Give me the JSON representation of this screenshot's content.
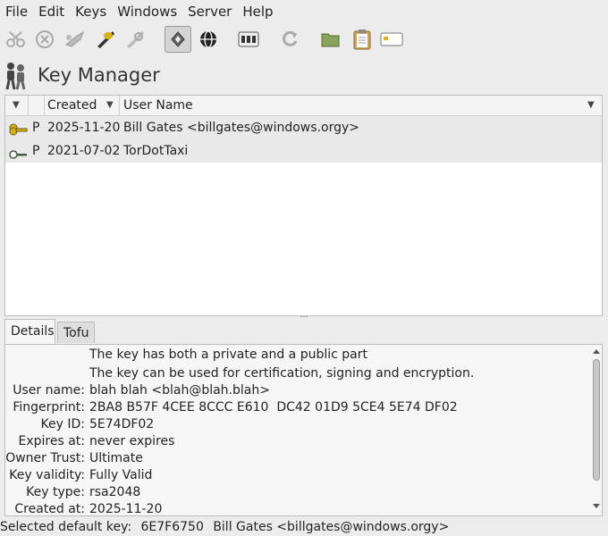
{
  "menu": [
    "File",
    "Edit",
    "Keys",
    "Windows",
    "Server",
    "Help"
  ],
  "toolbar": {
    "buttons": [
      {
        "icon": "scissors-icon",
        "enabled": false
      },
      {
        "icon": "delete-icon",
        "enabled": false
      },
      {
        "icon": "sign-key-icon",
        "enabled": false
      },
      {
        "icon": "edit-key-icon",
        "enabled": true
      },
      {
        "icon": "edit-key-alt-icon",
        "enabled": false
      },
      {
        "icon": "key-manager-icon",
        "enabled": true,
        "active": true
      },
      {
        "icon": "globe-icon",
        "enabled": true
      },
      {
        "icon": "keyring-icon",
        "enabled": true
      },
      {
        "icon": "refresh-icon",
        "enabled": false
      },
      {
        "icon": "folder-icon",
        "enabled": true
      },
      {
        "icon": "clipboard-icon",
        "enabled": true
      },
      {
        "icon": "card-icon",
        "enabled": true
      }
    ]
  },
  "page": {
    "title": "Key Manager",
    "icon": "keys-people-icon"
  },
  "table": {
    "headers": {
      "col0": "",
      "col1": "",
      "created": "Created",
      "user_name": "User Name"
    },
    "rows": [
      {
        "icon": "key-pair-icon",
        "type": "P",
        "created": "2025-11-20",
        "user_name": "Bill Gates <billgates@windows.orgy>"
      },
      {
        "icon": "public-key-icon",
        "type": "P",
        "created": "2021-07-02",
        "user_name": "TorDotTaxi"
      }
    ]
  },
  "tabs": [
    {
      "label": "Details",
      "active": true
    },
    {
      "label": "Tofu",
      "active": false
    }
  ],
  "details": {
    "note1": "The key has both a private and a public part",
    "note2": "The key can be used for certification, signing and encryption.",
    "fields": [
      {
        "label": "User name:",
        "value": "blah blah <blah@blah.blah>"
      },
      {
        "label": "Fingerprint:",
        "value": "2BA8 B57F 4CEE 8CCC E610  DC42 01D9 5CE4 5E74 DF02"
      },
      {
        "label": "Key ID:",
        "value": "5E74DF02"
      },
      {
        "label": "Expires at:",
        "value": "never expires"
      },
      {
        "label": "Owner Trust:",
        "value": "Ultimate"
      },
      {
        "label": "Key validity:",
        "value": "Fully Valid"
      },
      {
        "label": "Key type:",
        "value": "rsa2048"
      },
      {
        "label": "Created at:",
        "value": "2025-11-20"
      }
    ]
  },
  "status": {
    "label": "Selected default key:",
    "key_id": "6E7F6750",
    "user": "Bill Gates <billgates@windows.orgy>"
  },
  "colors": {
    "window_bg": "#ececec",
    "row_bg": "#e9e9e9",
    "key_gold": "#d8b21e"
  }
}
